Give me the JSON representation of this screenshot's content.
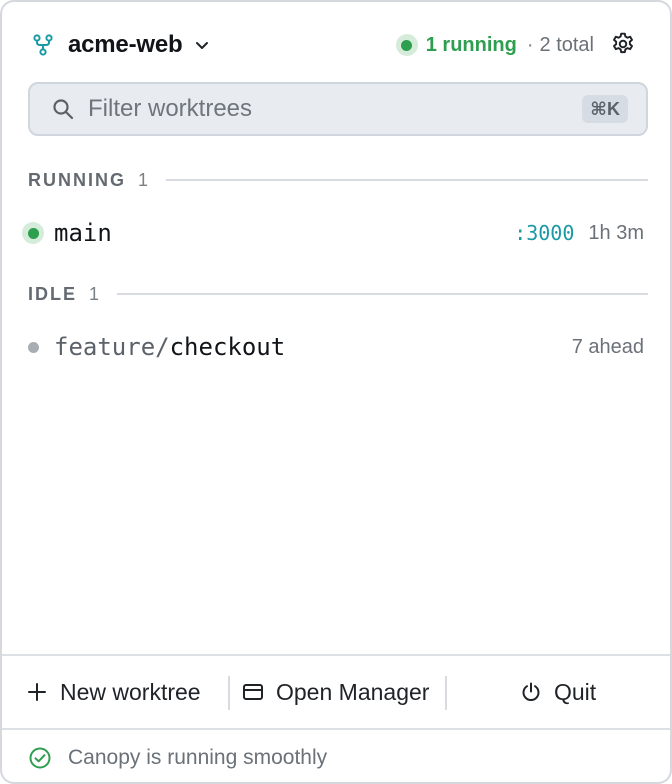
{
  "header": {
    "repo_name": "acme-web",
    "running_label": "1 running",
    "separator": "·",
    "total_label": "2 total"
  },
  "search": {
    "placeholder": "Filter worktrees",
    "value": "",
    "shortcut": "⌘K"
  },
  "sections": {
    "running": {
      "title": "RUNNING",
      "count": "1",
      "items": [
        {
          "name": "main",
          "port": ":3000",
          "meta": "1h 3m",
          "status_color": "#2e9e4f"
        }
      ]
    },
    "idle": {
      "title": "IDLE",
      "count": "1",
      "items": [
        {
          "name_prefix": "feature/",
          "name_rest": "checkout",
          "meta": "7 ahead",
          "status_color": "#a8adb3"
        }
      ]
    }
  },
  "footer": {
    "new_worktree": "New worktree",
    "open_manager": "Open Manager",
    "quit": "Quit"
  },
  "statusbar": {
    "text": "Canopy is running smoothly"
  },
  "colors": {
    "accent_green": "#2e9e4f",
    "port_teal": "#1a9aa5",
    "idle_gray": "#a8adb3"
  }
}
